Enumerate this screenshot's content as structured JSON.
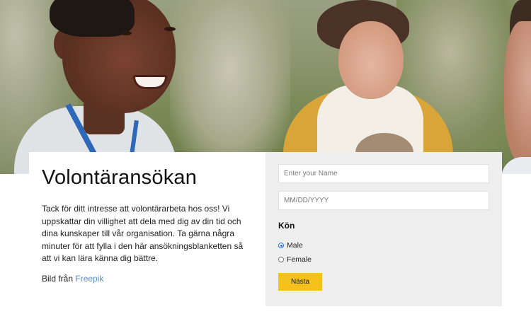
{
  "hero": {
    "image_name": "volunteers-photo"
  },
  "intro": {
    "title": "Volontäransökan",
    "description": "Tack för ditt intresse att volontärarbeta hos oss! Vi uppskattar din villighet att dela med dig av din tid och dina kunskaper till vår organisation. Ta gärna några minuter för att fylla i den här ansökningsblanketten så att vi kan lära känna dig bättre.",
    "credit_prefix": "Bild från",
    "credit_link": "Freepik",
    "link_color": "#5b8fc7"
  },
  "form": {
    "name_placeholder": "Enter your Name",
    "date_placeholder": "MM/DD/YYYY",
    "gender_label": "Kön",
    "gender_options": [
      {
        "label": "Male",
        "selected": true
      },
      {
        "label": "Female",
        "selected": false
      }
    ],
    "submit_label": "Nästa",
    "submit_color": "#f4c21b",
    "background_color": "#eeeeee"
  }
}
